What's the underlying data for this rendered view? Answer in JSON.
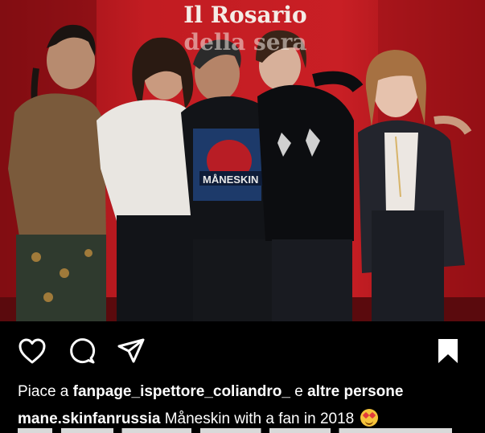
{
  "post": {
    "sign_text_line1": "Il Rosario",
    "sign_text_line2": "della sera",
    "badge_text": "MÅNESKIN",
    "likes_prefix": "Piace a",
    "likes_user": "fanpage_ispettore_coliandro_",
    "likes_joiner": "e",
    "likes_others": "altre persone",
    "caption_user": "mane.skinfanrussia",
    "caption_text": "Måneskin with a fan in 2018",
    "caption_emoji": "star-struck-emoji"
  },
  "icons": {
    "like": "heart-icon",
    "comment": "comment-icon",
    "share": "send-icon",
    "save": "bookmark-icon"
  },
  "colors": {
    "background": "#000000",
    "backdrop_red": "#b3161b",
    "text": "#ffffff"
  }
}
